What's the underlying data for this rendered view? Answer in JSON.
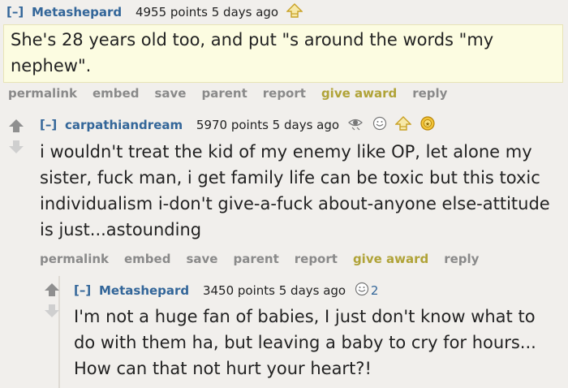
{
  "comments": [
    {
      "toggle": "[–]",
      "author": "Metashepard",
      "score_time": "4955 points 5 days ago",
      "body": "She's 28 years old too, and put \"s around the words \"my nephew\".",
      "buttons": [
        "permalink",
        "embed",
        "save",
        "parent",
        "report",
        "give award",
        "reply"
      ],
      "icons": [
        "upvote-outline-icon"
      ]
    },
    {
      "toggle": "[–]",
      "author": "carpathiandream",
      "score_time": "5970 points 5 days ago",
      "body": "i wouldn't treat the kid of my enemy like OP, let alone my sister, fuck man, i get family life can be toxic but this toxic individualism i-don't give-a-fuck about-anyone else-attitude is just...astounding",
      "buttons": [
        "permalink",
        "embed",
        "save",
        "parent",
        "report",
        "give award",
        "reply"
      ],
      "icons": [
        "eye-award-icon",
        "smile-award-icon",
        "upvote-outline-icon",
        "gold-award-icon"
      ]
    },
    {
      "toggle": "[–]",
      "author": "Metashepard",
      "score_time": "3450 points 5 days ago",
      "award_count": "2",
      "body": "I'm not a huge fan of babies, I just don't know what to do with them ha, but leaving a baby to cry for hours... How can that not hurt your heart?!",
      "icons": [
        "smile-award-icon"
      ]
    }
  ],
  "colors": {
    "background": "#f1efec",
    "link": "#336699",
    "award": "#b0a338",
    "highlight": "#fcfce1",
    "button": "#8a8a8a"
  }
}
